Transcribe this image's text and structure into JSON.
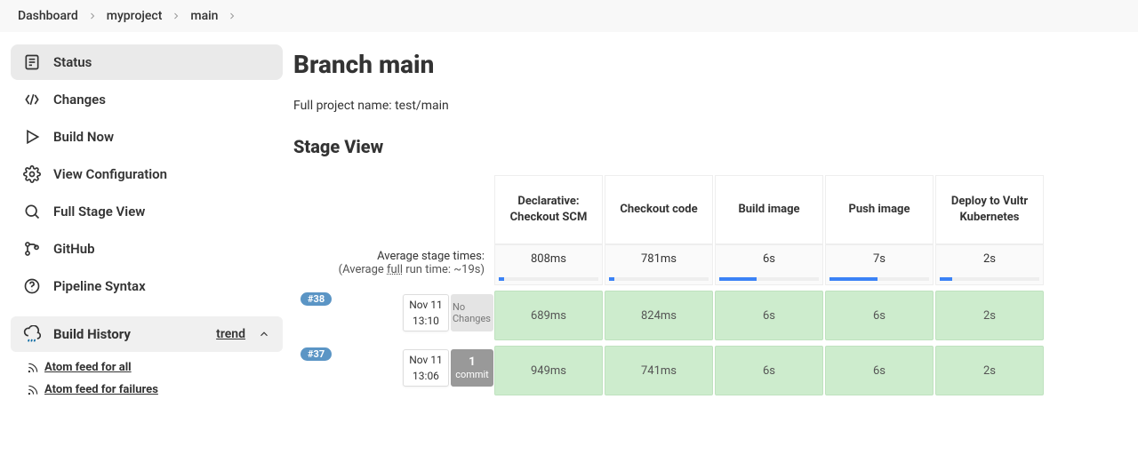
{
  "breadcrumb": [
    {
      "label": "Dashboard"
    },
    {
      "label": "myproject"
    },
    {
      "label": "main"
    }
  ],
  "sidebar": {
    "items": [
      {
        "label": "Status",
        "name": "sidebar-item-status",
        "icon": "status",
        "active": true
      },
      {
        "label": "Changes",
        "name": "sidebar-item-changes",
        "icon": "changes"
      },
      {
        "label": "Build Now",
        "name": "sidebar-item-build-now",
        "icon": "play"
      },
      {
        "label": "View Configuration",
        "name": "sidebar-item-view-config",
        "icon": "gear"
      },
      {
        "label": "Full Stage View",
        "name": "sidebar-item-full-stage",
        "icon": "search"
      },
      {
        "label": "GitHub",
        "name": "sidebar-item-github",
        "icon": "git"
      },
      {
        "label": "Pipeline Syntax",
        "name": "sidebar-item-pipeline-syntax",
        "icon": "help"
      }
    ],
    "build_history": "Build History",
    "trend": "trend",
    "feed_all": "Atom feed for all",
    "feed_fail": "Atom feed for failures"
  },
  "page": {
    "title": "Branch main",
    "subtitle": "Full project name: test/main",
    "stage_view": "Stage View"
  },
  "stages": {
    "headers": [
      "Declarative: Checkout SCM",
      "Checkout code",
      "Build image",
      "Push image",
      "Deploy to Vultr Kubernetes"
    ],
    "avg_label": "Average stage times:",
    "avg_sub_prefix": "(Average ",
    "avg_sub_full": "full",
    "avg_sub_suffix": " run time: ~19s)",
    "avg": [
      {
        "value": "808ms",
        "pct": 5
      },
      {
        "value": "781ms",
        "pct": 5
      },
      {
        "value": "6s",
        "pct": 35
      },
      {
        "value": "7s",
        "pct": 45
      },
      {
        "value": "2s",
        "pct": 12
      }
    ],
    "runs": [
      {
        "badge": "#38",
        "date": "Nov 11",
        "time": "13:10",
        "changes_mode": "none",
        "changes_text": "No Changes",
        "changes_count": "",
        "cells": [
          "689ms",
          "824ms",
          "6s",
          "6s",
          "2s"
        ]
      },
      {
        "badge": "#37",
        "date": "Nov 11",
        "time": "13:06",
        "changes_mode": "some",
        "changes_text": "commit",
        "changes_count": "1",
        "cells": [
          "949ms",
          "741ms",
          "6s",
          "6s",
          "2s"
        ]
      }
    ]
  }
}
